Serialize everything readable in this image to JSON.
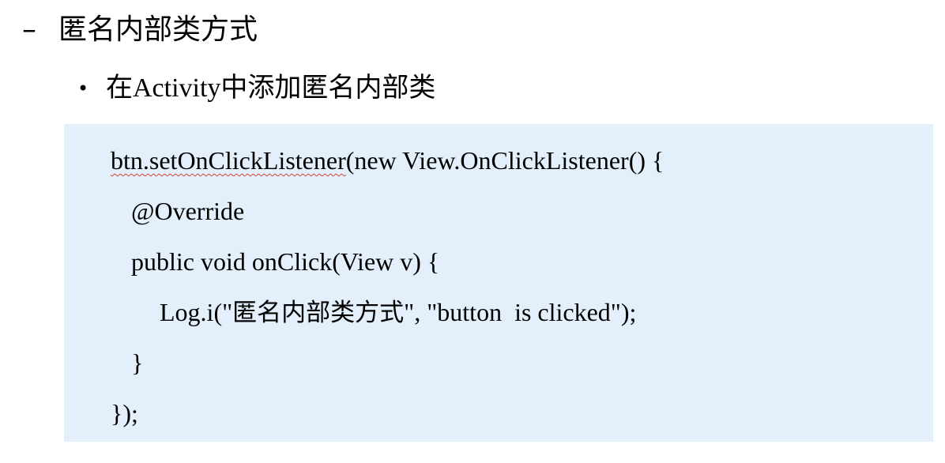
{
  "heading": {
    "marker": "–",
    "text": "匿名内部类方式"
  },
  "bullet": {
    "marker": "•",
    "text": "在Activity中添加匿名内部类"
  },
  "code": {
    "line1_flagged": "btn.setOnClickListener",
    "line1_rest": "(new View.OnClickListener() {",
    "line2": "@Override",
    "line3": "public void onClick(View v) {",
    "line4_prefix": "Log.i(\"",
    "line4_cjk": "匿名内部类方式",
    "line4_suffix": "\", \"button  is clicked\");",
    "line5": "}",
    "line6": "});"
  }
}
